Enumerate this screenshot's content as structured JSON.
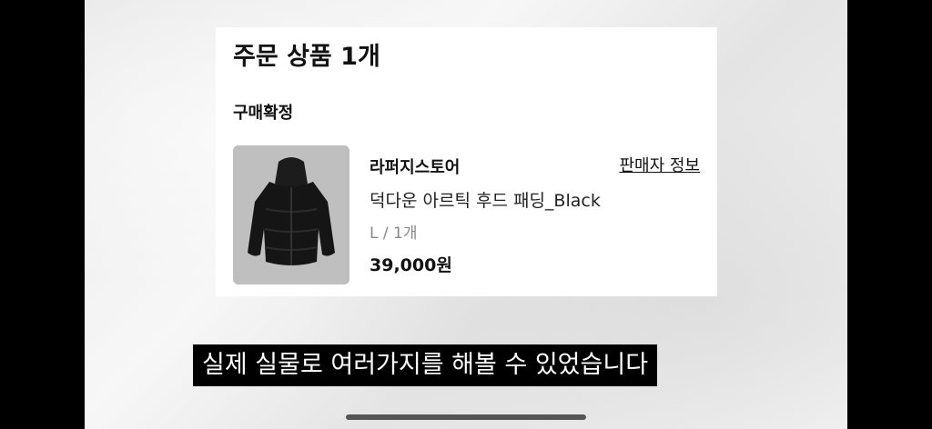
{
  "order": {
    "title": "주문 상품 1개",
    "status": "구매확정",
    "item": {
      "store": "라퍼지스토어",
      "seller_info_link": "판매자 정보",
      "product_name": "덕다운 아르틱 후드 패딩_Black",
      "option": "L / 1개",
      "price": "39,000원",
      "image_icon": "black-puffer-jacket-image"
    }
  },
  "subtitle": "실제 실물로 여러가지를 해볼 수 있었습니다",
  "colors": {
    "card_background": "#ffffff",
    "thumbnail_background": "#bdbdbd",
    "subtitle_background": "#000000",
    "subtitle_text": "#ffffff"
  }
}
